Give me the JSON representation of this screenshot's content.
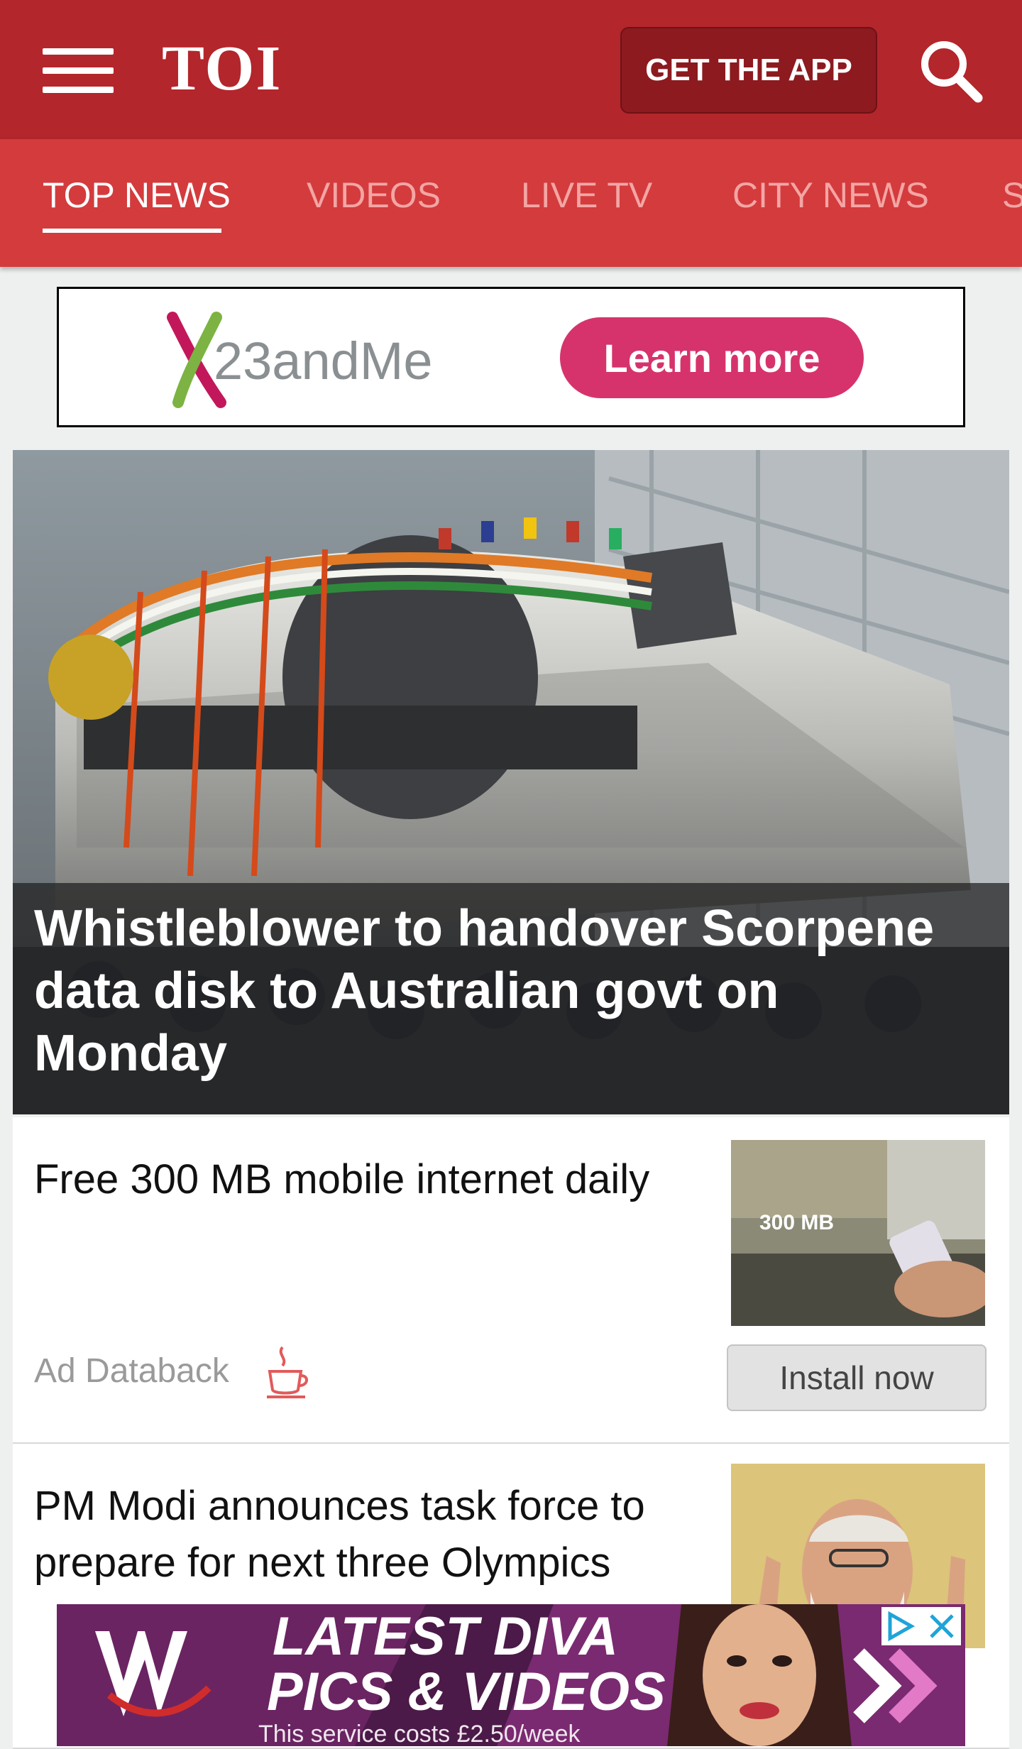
{
  "header": {
    "logo": "TOI",
    "get_app_label": "GET THE APP"
  },
  "tabs": [
    {
      "label": "TOP NEWS",
      "active": true
    },
    {
      "label": "VIDEOS",
      "active": false
    },
    {
      "label": "LIVE TV",
      "active": false
    },
    {
      "label": "CITY NEWS",
      "active": false
    },
    {
      "label": "S",
      "active": false
    }
  ],
  "top_ad": {
    "brand": "23andMe",
    "button_label": "Learn more"
  },
  "hero": {
    "headline": "Whistleblower to handover Scorpene data disk to Australian govt on Monday"
  },
  "sponsored": {
    "title": "Free 300 MB mobile internet daily",
    "label": "Ad Databack",
    "thumb_text": "300 MB",
    "button_label": "Install now"
  },
  "story2": {
    "title": "PM Modi announces task force to prepare for next three Olympics"
  },
  "bottom_ad": {
    "line1": "LATEST DIVA",
    "line2": "PICS & VIDEOS",
    "fine_print": "This service costs £2.50/week"
  },
  "icons": [
    "menu-icon",
    "search-icon",
    "coffee-cup-icon",
    "adchoices-icon",
    "close-icon",
    "double-chevron-icon"
  ],
  "colors": {
    "header_red": "#b3262b",
    "tab_red": "#d43b3d",
    "learn_more_pink": "#d6336c"
  }
}
